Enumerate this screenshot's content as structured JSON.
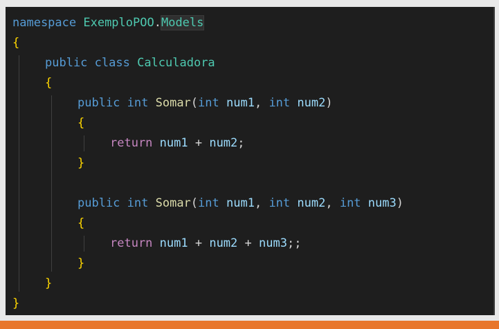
{
  "colors": {
    "background": "#1e1e1e",
    "keyword": "#569cd6",
    "control_keyword": "#c586c0",
    "namespace": "#4ec9b0",
    "class_name": "#4ec9b0",
    "method": "#dcdcaa",
    "variable": "#9cdcfe",
    "punctuation": "#d4d4d4",
    "brace": "#ffd700",
    "accent_bar": "#e8762b"
  },
  "code": {
    "lines": [
      {
        "indent": 0,
        "tokens": [
          {
            "text": "namespace ",
            "type": "keyword"
          },
          {
            "text": "ExemploPOO",
            "type": "namespace"
          },
          {
            "text": ".",
            "type": "punctuation"
          },
          {
            "text": "Models",
            "type": "namespace",
            "highlight": true
          }
        ]
      },
      {
        "indent": 0,
        "tokens": [
          {
            "text": "{",
            "type": "brace"
          }
        ]
      },
      {
        "indent": 1,
        "tokens": [
          {
            "text": "public ",
            "type": "keyword"
          },
          {
            "text": "class ",
            "type": "keyword"
          },
          {
            "text": "Calculadora",
            "type": "class_name"
          }
        ]
      },
      {
        "indent": 1,
        "tokens": [
          {
            "text": "{",
            "type": "brace"
          }
        ]
      },
      {
        "indent": 2,
        "tokens": [
          {
            "text": "public ",
            "type": "keyword"
          },
          {
            "text": "int ",
            "type": "keyword"
          },
          {
            "text": "Somar",
            "type": "method"
          },
          {
            "text": "(",
            "type": "punctuation"
          },
          {
            "text": "int ",
            "type": "keyword"
          },
          {
            "text": "num1",
            "type": "variable"
          },
          {
            "text": ", ",
            "type": "punctuation"
          },
          {
            "text": "int ",
            "type": "keyword"
          },
          {
            "text": "num2",
            "type": "variable"
          },
          {
            "text": ")",
            "type": "punctuation"
          }
        ]
      },
      {
        "indent": 2,
        "tokens": [
          {
            "text": "{",
            "type": "brace"
          }
        ]
      },
      {
        "indent": 3,
        "tokens": [
          {
            "text": "return ",
            "type": "control_keyword"
          },
          {
            "text": "num1",
            "type": "variable"
          },
          {
            "text": " + ",
            "type": "punctuation"
          },
          {
            "text": "num2",
            "type": "variable"
          },
          {
            "text": ";",
            "type": "punctuation"
          }
        ]
      },
      {
        "indent": 2,
        "tokens": [
          {
            "text": "}",
            "type": "brace"
          }
        ]
      },
      {
        "indent": 0,
        "tokens": []
      },
      {
        "indent": 2,
        "tokens": [
          {
            "text": "public ",
            "type": "keyword"
          },
          {
            "text": "int ",
            "type": "keyword"
          },
          {
            "text": "Somar",
            "type": "method"
          },
          {
            "text": "(",
            "type": "punctuation"
          },
          {
            "text": "int ",
            "type": "keyword"
          },
          {
            "text": "num1",
            "type": "variable"
          },
          {
            "text": ", ",
            "type": "punctuation"
          },
          {
            "text": "int ",
            "type": "keyword"
          },
          {
            "text": "num2",
            "type": "variable"
          },
          {
            "text": ", ",
            "type": "punctuation"
          },
          {
            "text": "int ",
            "type": "keyword"
          },
          {
            "text": "num3",
            "type": "variable"
          },
          {
            "text": ")",
            "type": "punctuation"
          }
        ]
      },
      {
        "indent": 2,
        "tokens": [
          {
            "text": "{",
            "type": "brace"
          }
        ]
      },
      {
        "indent": 3,
        "tokens": [
          {
            "text": "return ",
            "type": "control_keyword"
          },
          {
            "text": "num1",
            "type": "variable"
          },
          {
            "text": " + ",
            "type": "punctuation"
          },
          {
            "text": "num2",
            "type": "variable"
          },
          {
            "text": " + ",
            "type": "punctuation"
          },
          {
            "text": "num3",
            "type": "variable"
          },
          {
            "text": ";;",
            "type": "punctuation"
          }
        ]
      },
      {
        "indent": 2,
        "tokens": [
          {
            "text": "}",
            "type": "brace"
          }
        ]
      },
      {
        "indent": 1,
        "tokens": [
          {
            "text": "}",
            "type": "brace"
          }
        ]
      },
      {
        "indent": 0,
        "tokens": [
          {
            "text": "}",
            "type": "brace"
          }
        ]
      }
    ]
  }
}
